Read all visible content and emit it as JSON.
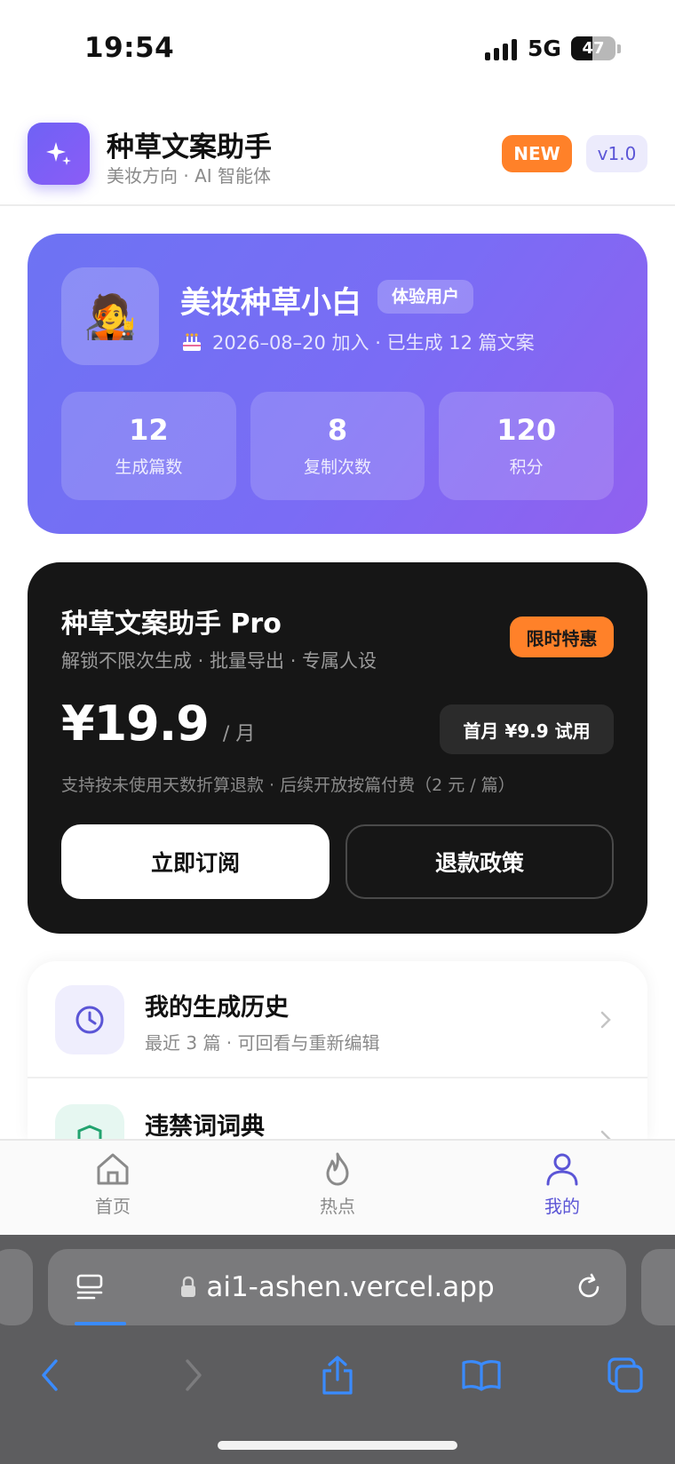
{
  "status_bar": {
    "time": "19:54",
    "network": "5G",
    "battery": "47",
    "battery_level": 0.47
  },
  "header": {
    "title": "种草文案助手",
    "subtitle": "美妆方向 · AI 智能体",
    "new_badge": "NEW",
    "version": "v1.0"
  },
  "profile": {
    "avatar": "🧑‍🎤",
    "name": "美妆种草小白",
    "role": "体验用户",
    "meta": "2026–08–20 加入 · 已生成 12 篇文案",
    "stats": [
      {
        "value": "12",
        "label": "生成篇数"
      },
      {
        "value": "8",
        "label": "复制次数"
      },
      {
        "value": "120",
        "label": "积分"
      }
    ]
  },
  "pro": {
    "title": "种草文案助手 Pro",
    "desc": "解锁不限次生成 · 批量导出 · 专属人设",
    "tag": "限时特惠",
    "price": "¥19.9",
    "unit": "/ 月",
    "trial": "首月 ¥9.9 试用",
    "note": "支持按未使用天数折算退款 · 后续开放按篇付费（2 元 / 篇）",
    "subscribe": "立即订阅",
    "refund": "退款政策"
  },
  "menu": [
    {
      "title": "我的生成历史",
      "desc": "最近 3 篇 · 可回看与重新编辑"
    },
    {
      "title": "违禁词词典"
    }
  ],
  "tabs": [
    {
      "label": "首页"
    },
    {
      "label": "热点"
    },
    {
      "label": "我的"
    }
  ],
  "browser": {
    "url": "ai1-ashen.vercel.app"
  },
  "colors": {
    "accent": "#5b55d6",
    "orange": "#ff8129",
    "card_dark": "#161616"
  },
  "icons": [
    "sparkle-icon",
    "cake-icon",
    "clock-icon",
    "shield-icon",
    "chevron-right-icon",
    "home-icon",
    "flame-icon",
    "user-icon",
    "tabs-icon",
    "lock-icon",
    "reload-icon",
    "back-icon",
    "forward-icon",
    "share-icon",
    "bookmarks-icon",
    "tabs-overview-icon"
  ]
}
